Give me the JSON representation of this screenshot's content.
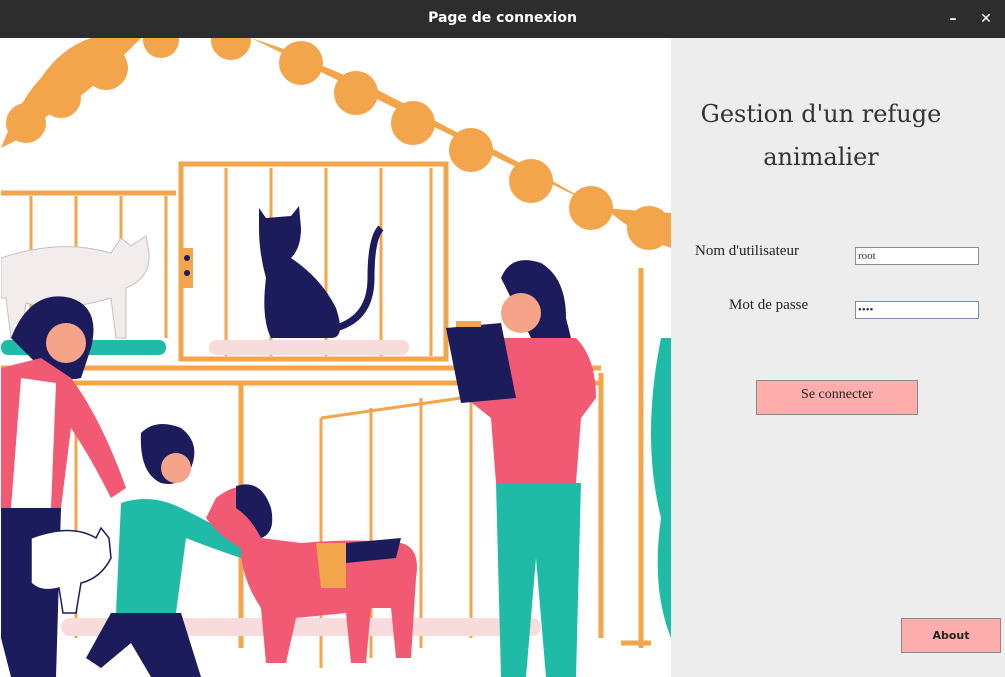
{
  "window": {
    "title": "Page de connexion",
    "minimize_label": "–",
    "close_label": "✕"
  },
  "illustration": {
    "description_icon": "animal-shelter-illustration-icon"
  },
  "login": {
    "heading_line1": "Gestion d'un refuge",
    "heading_line2": "animalier",
    "username_label": "Nom d'utilisateur",
    "username_value": "root",
    "password_label": "Mot de passe",
    "password_value": "••••",
    "connect_button": "Se connecter",
    "about_button": "About"
  },
  "colors": {
    "accent_pink": "#ffadad",
    "panel_bg": "#ededed",
    "titlebar_bg": "#2d2d2d",
    "orange": "#f2a54a",
    "navy": "#1c1c5c",
    "coral": "#f25a74",
    "teal": "#1fbba6"
  }
}
